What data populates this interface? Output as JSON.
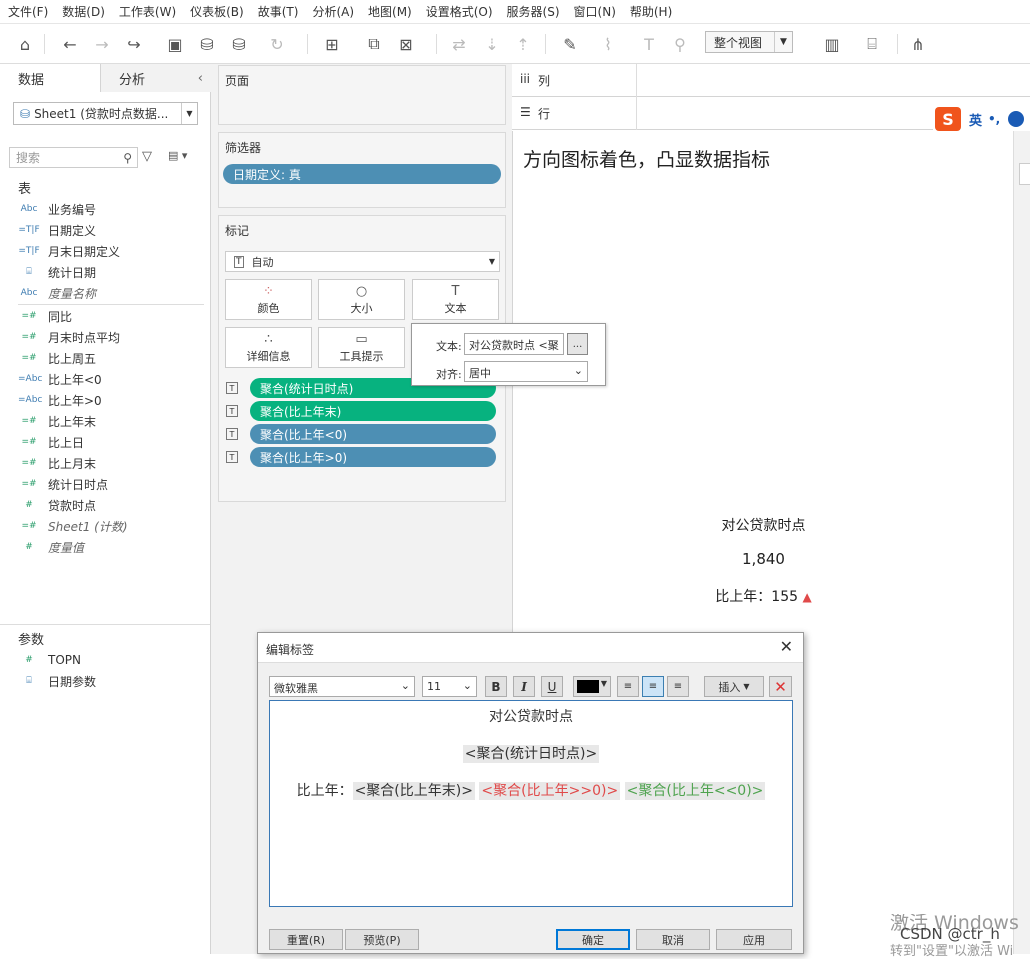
{
  "menu": [
    "文件(F)",
    "数据(D)",
    "工作表(W)",
    "仪表板(B)",
    "故事(T)",
    "分析(A)",
    "地图(M)",
    "设置格式(O)",
    "服务器(S)",
    "窗口(N)",
    "帮助(H)"
  ],
  "toolbar": {
    "view_mode": "整个视图"
  },
  "left": {
    "tab_data": "数据",
    "tab_analysis": "分析",
    "datasource": "Sheet1 (贷款时点数据...",
    "search_placeholder": "搜索",
    "section_tables": "表",
    "dimensions": [
      {
        "type": "Abc",
        "name": "业务编号"
      },
      {
        "type": "=T|F",
        "name": "日期定义"
      },
      {
        "type": "=T|F",
        "name": "月末日期定义"
      },
      {
        "type": "cal",
        "name": "统计日期"
      },
      {
        "type": "Abc",
        "name": "度量名称",
        "italic": true
      }
    ],
    "measures": [
      {
        "type": "=#",
        "name": "同比"
      },
      {
        "type": "=#",
        "name": "月末时点平均"
      },
      {
        "type": "=#",
        "name": "比上周五"
      },
      {
        "type": "=Abc",
        "name": "比上年<0"
      },
      {
        "type": "=Abc",
        "name": "比上年>0"
      },
      {
        "type": "=#",
        "name": "比上年末"
      },
      {
        "type": "=#",
        "name": "比上日"
      },
      {
        "type": "=#",
        "name": "比上月末"
      },
      {
        "type": "=#",
        "name": "统计日时点"
      },
      {
        "type": "#",
        "name": "贷款时点"
      },
      {
        "type": "=#",
        "name": "Sheet1 (计数)",
        "italic": true
      },
      {
        "type": "#",
        "name": "度量值",
        "italic": true
      }
    ],
    "section_params": "参数",
    "params": [
      {
        "type": "#",
        "name": "TOPN"
      },
      {
        "type": "cal",
        "name": "日期参数"
      }
    ]
  },
  "cards": {
    "pages": "页面",
    "filters": "筛选器",
    "filter_pill": "日期定义: 真",
    "marks": "标记",
    "mark_type": "自动",
    "buttons": [
      "颜色",
      "大小",
      "文本",
      "详细信息",
      "工具提示"
    ],
    "mark_pills": [
      {
        "label": "聚合(统计日时点)",
        "color": "green"
      },
      {
        "label": "聚合(比上年末)",
        "color": "green"
      },
      {
        "label": "聚合(比上年<0)",
        "color": "blue"
      },
      {
        "label": "聚合(比上年>0)",
        "color": "blue"
      }
    ]
  },
  "shelves": {
    "columns": "列",
    "rows": "行"
  },
  "view": {
    "title": "方向图标着色，凸显数据指标",
    "label1": "对公贷款时点",
    "value": "1,840",
    "compare_label": "比上年：155",
    "compare_icon": "▲"
  },
  "popover": {
    "text_label": "文本:",
    "text_value": "对公贷款时点  <聚",
    "align_label": "对齐:",
    "align_value": "居中",
    "more": "..."
  },
  "dialog": {
    "title": "编辑标签",
    "font": "微软雅黑",
    "size": "11",
    "insert": "插入",
    "line1": "对公贷款时点",
    "line2": "<聚合(统计日时点)>",
    "line3_prefix": "比上年：",
    "line3_f1": "<聚合(比上年末)>",
    "line3_f2": "<聚合(比上年>>0)>",
    "line3_f3": "<聚合(比上年<<0)>",
    "reset": "重置(R)",
    "preview": "预览(P)",
    "ok": "确定",
    "cancel": "取消",
    "apply": "应用"
  },
  "watermark": {
    "line1": "激活 Windows",
    "line2": "CSDN @ctr_h",
    "line3": "转到\"设置\"以激活 Wi"
  },
  "ime": {
    "label": "英"
  },
  "colors": {
    "green": "#07b27f",
    "blue": "#4d8fb4",
    "red": "#e04a4a",
    "accent_green": "#4fa34f"
  }
}
